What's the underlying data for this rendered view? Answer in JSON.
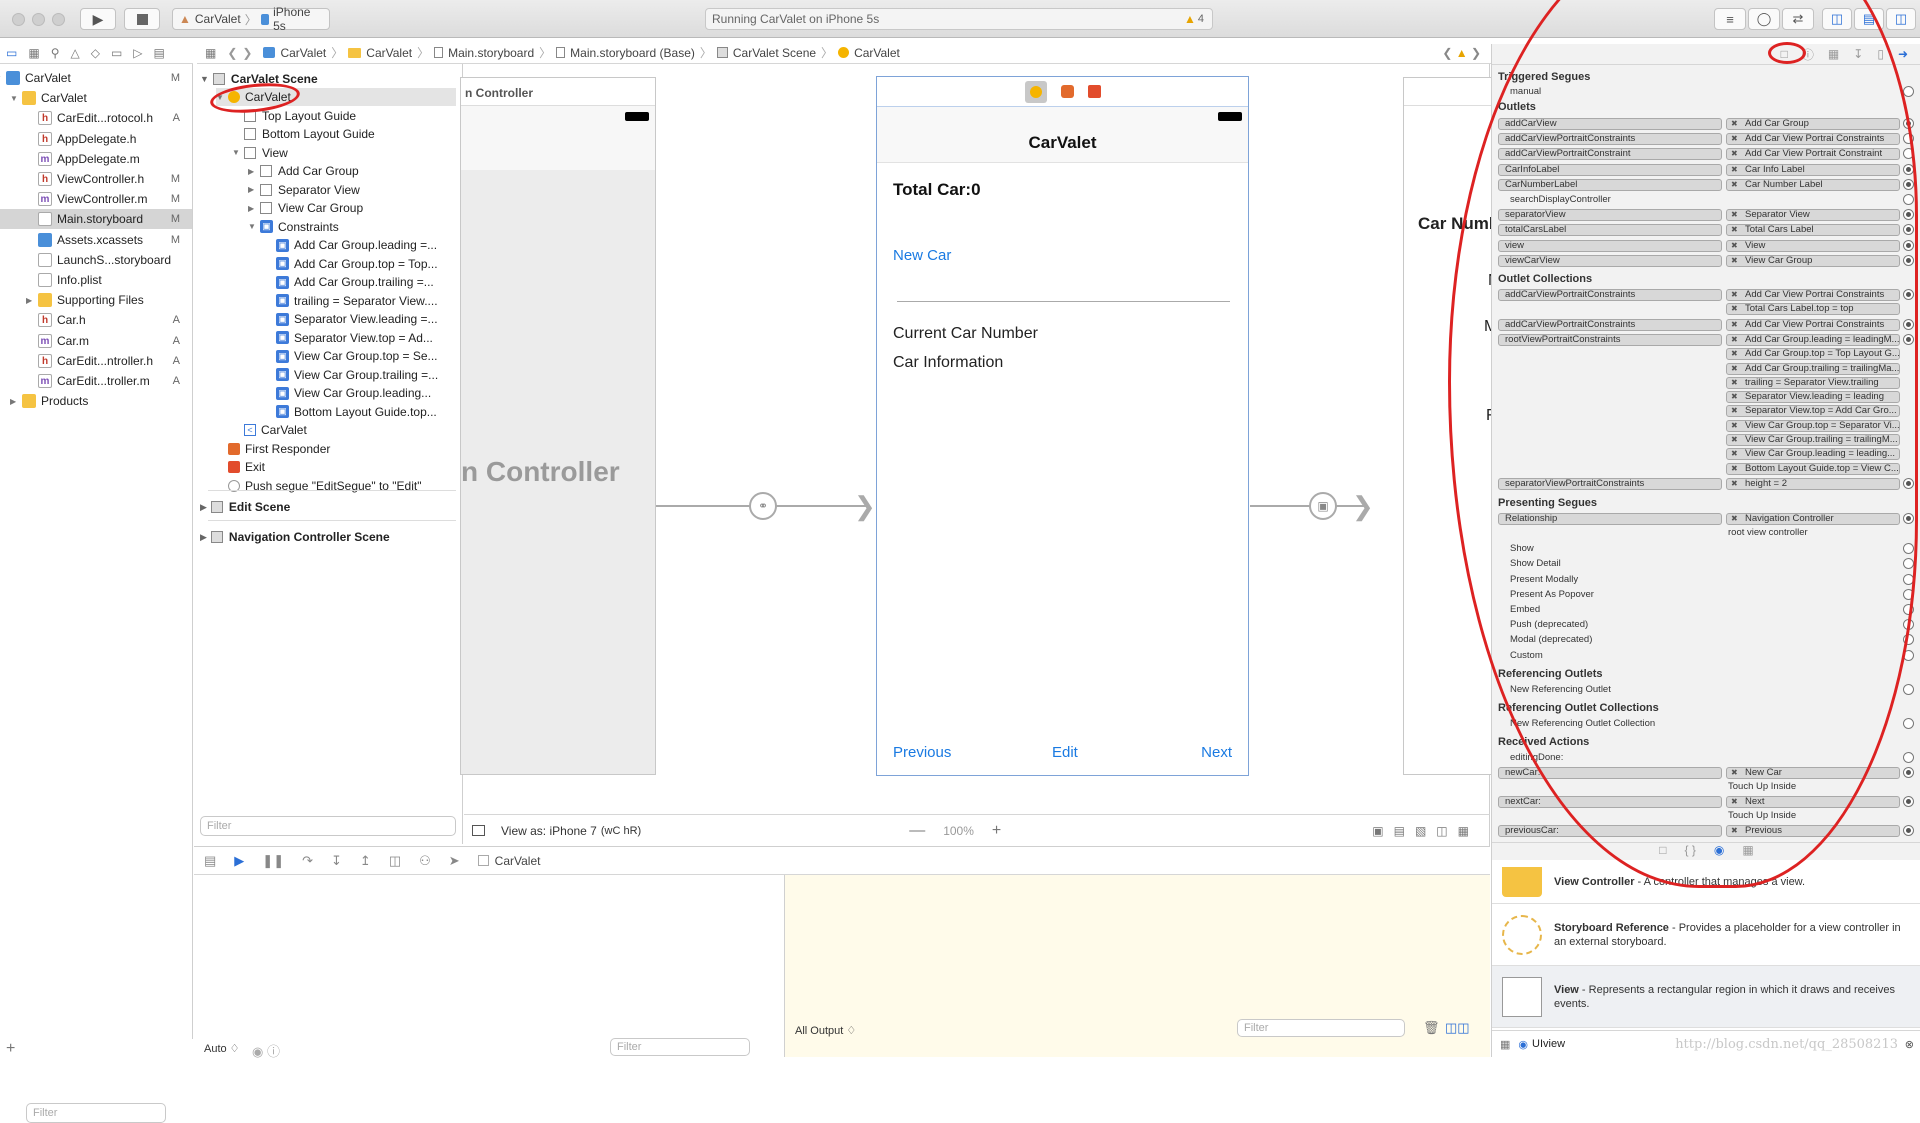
{
  "toolbar": {
    "scheme_app": "CarValet",
    "scheme_device": "iPhone 5s",
    "activity": "Running CarValet on iPhone 5s",
    "warning_count": "4"
  },
  "jumpbar": [
    "CarValet",
    "CarValet",
    "Main.storyboard",
    "Main.storyboard (Base)",
    "CarValet Scene",
    "CarValet"
  ],
  "navigator": {
    "items": [
      {
        "label": "CarValet",
        "badge": "M",
        "level": 0,
        "type": "project"
      },
      {
        "label": "CarValet",
        "badge": "",
        "level": 1,
        "type": "folder"
      },
      {
        "label": "CarEdit...rotocol.h",
        "badge": "A",
        "level": 2,
        "type": "h"
      },
      {
        "label": "AppDelegate.h",
        "badge": "",
        "level": 2,
        "type": "h"
      },
      {
        "label": "AppDelegate.m",
        "badge": "",
        "level": 2,
        "type": "m"
      },
      {
        "label": "ViewController.h",
        "badge": "M",
        "level": 2,
        "type": "h"
      },
      {
        "label": "ViewController.m",
        "badge": "M",
        "level": 2,
        "type": "m"
      },
      {
        "label": "Main.storyboard",
        "badge": "M",
        "level": 2,
        "type": "sb",
        "selected": true
      },
      {
        "label": "Assets.xcassets",
        "badge": "M",
        "level": 2,
        "type": "assets"
      },
      {
        "label": "LaunchS...storyboard",
        "badge": "",
        "level": 2,
        "type": "sb"
      },
      {
        "label": "Info.plist",
        "badge": "",
        "level": 2,
        "type": "plist"
      },
      {
        "label": "Supporting Files",
        "badge": "",
        "level": 2,
        "type": "folder"
      },
      {
        "label": "Car.h",
        "badge": "A",
        "level": 2,
        "type": "h"
      },
      {
        "label": "Car.m",
        "badge": "A",
        "level": 2,
        "type": "m"
      },
      {
        "label": "CarEdit...ntroller.h",
        "badge": "A",
        "level": 2,
        "type": "h"
      },
      {
        "label": "CarEdit...troller.m",
        "badge": "A",
        "level": 2,
        "type": "m"
      },
      {
        "label": "Products",
        "badge": "",
        "level": 1,
        "type": "folder"
      }
    ],
    "filter_placeholder": "Filter"
  },
  "outline": {
    "scene_title": "CarValet Scene",
    "items": [
      {
        "label": "CarValet",
        "level": 1,
        "kind": "vc"
      },
      {
        "label": "Top Layout Guide",
        "level": 2,
        "kind": "box"
      },
      {
        "label": "Bottom Layout Guide",
        "level": 2,
        "kind": "box"
      },
      {
        "label": "View",
        "level": 2,
        "kind": "box"
      },
      {
        "label": "Add Car Group",
        "level": 3,
        "kind": "box"
      },
      {
        "label": "Separator View",
        "level": 3,
        "kind": "box"
      },
      {
        "label": "View Car Group",
        "level": 3,
        "kind": "box"
      },
      {
        "label": "Constraints",
        "level": 3,
        "kind": "cons"
      },
      {
        "label": "Add Car Group.leading =...",
        "level": 4,
        "kind": "c"
      },
      {
        "label": "Add Car Group.top = Top...",
        "level": 4,
        "kind": "c"
      },
      {
        "label": "Add Car Group.trailing =...",
        "level": 4,
        "kind": "c"
      },
      {
        "label": "trailing = Separator View....",
        "level": 4,
        "kind": "c"
      },
      {
        "label": "Separator View.leading =...",
        "level": 4,
        "kind": "c"
      },
      {
        "label": "Separator View.top = Ad...",
        "level": 4,
        "kind": "c"
      },
      {
        "label": "View Car Group.top = Se...",
        "level": 4,
        "kind": "c"
      },
      {
        "label": "View Car Group.trailing =...",
        "level": 4,
        "kind": "c"
      },
      {
        "label": "View Car Group.leading...",
        "level": 4,
        "kind": "c"
      },
      {
        "label": "Bottom Layout Guide.top...",
        "level": 4,
        "kind": "c"
      },
      {
        "label": "CarValet",
        "level": 2,
        "kind": "nav"
      },
      {
        "label": "First Responder",
        "level": 1,
        "kind": "fr"
      },
      {
        "label": "Exit",
        "level": 1,
        "kind": "exit"
      },
      {
        "label": "Push segue \"EditSegue\" to \"Edit\"",
        "level": 1,
        "kind": "segue"
      }
    ],
    "other_scenes": [
      "Edit Scene",
      "Navigation Controller Scene"
    ],
    "filter_placeholder": "Filter"
  },
  "canvas": {
    "left_scene_title": "n Controller",
    "left_scene_big": "n Controller",
    "nav_title": "CarValet",
    "total_car": "Total Car:0",
    "new_car": "New Car",
    "current_car": "Current Car Number",
    "car_info": "Car Information",
    "previous": "Previous",
    "edit": "Edit",
    "next": "Next",
    "right_partial_1": "Car Numb",
    "right_partial_2": "M",
    "right_partial_3": "M",
    "right_partial_4": "F",
    "view_as": "View as: iPhone 7",
    "size_class": "(wC hR)",
    "zoom": "100%"
  },
  "debug": {
    "breadcrumb": "CarValet",
    "auto": "Auto ♢",
    "all_output": "All Output ♢",
    "filter": "Filter"
  },
  "inspector": {
    "triggered_segues": "Triggered Segues",
    "manual": "manual",
    "outlets_title": "Outlets",
    "outlets": [
      {
        "name": "addCarView",
        "target": "Add Car Group",
        "on": true
      },
      {
        "name": "addCarViewPortraitConstraints",
        "target": "Add Car View Portrai Constraints",
        "on": false
      },
      {
        "name": "addCarViewPortraitConstraint",
        "target": "Add Car View Portrait Constraint",
        "on": false
      },
      {
        "name": "CarInfoLabel",
        "target": "Car Info Label",
        "on": true
      },
      {
        "name": "CarNumberLabel",
        "target": "Car Number Label",
        "on": true
      },
      {
        "name": "searchDisplayController",
        "target": "",
        "on": false
      },
      {
        "name": "separatorView",
        "target": "Separator View",
        "on": true
      },
      {
        "name": "totalCarsLabel",
        "target": "Total Cars Label",
        "on": true
      },
      {
        "name": "view",
        "target": "View",
        "on": true
      },
      {
        "name": "viewCarView",
        "target": "View Car Group",
        "on": true
      }
    ],
    "outlet_collections_title": "Outlet Collections",
    "collections": [
      {
        "name": "addCarViewPortraitConstraints",
        "targets": [
          "Add Car View Portrai Constraints",
          "Total Cars Label.top = top"
        ]
      },
      {
        "name": "addCarViewPortraitConstraints",
        "targets": [
          "Add Car View Portrai Constraints"
        ]
      },
      {
        "name": "rootViewPortraitConstraints",
        "targets": [
          "Add Car Group.leading = leadingM...",
          "Add Car Group.top = Top Layout G...",
          "Add Car Group.trailing = trailingMa...",
          "trailing = Separator View.trailing",
          "Separator View.leading = leading",
          "Separator View.top = Add Car Gro...",
          "View Car Group.top = Separator Vi...",
          "View Car Group.trailing = trailingM...",
          "View Car Group.leading = leading...",
          "Bottom Layout Guide.top = View C..."
        ]
      },
      {
        "name": "separatorViewPortraitConstraints",
        "targets": [
          "height = 2"
        ]
      }
    ],
    "presenting_title": "Presenting Segues",
    "relationship": "Relationship",
    "relationship_target": [
      "Navigation Controller",
      "root view controller"
    ],
    "segues": [
      "Show",
      "Show Detail",
      "Present Modally",
      "Present As Popover",
      "Embed",
      "Push (deprecated)",
      "Modal (deprecated)",
      "Custom"
    ],
    "ref_outlets_title": "Referencing Outlets",
    "new_ref_outlet": "New Referencing Outlet",
    "ref_coll_title": "Referencing Outlet Collections",
    "new_ref_coll": "New Referencing Outlet Collection",
    "received_title": "Received Actions",
    "actions": [
      {
        "name": "editingDone:",
        "targets": []
      },
      {
        "name": "newCar:",
        "targets": [
          "New Car",
          "Touch Up Inside"
        ]
      },
      {
        "name": "nextCar:",
        "targets": [
          "Next",
          "Touch Up Inside"
        ]
      },
      {
        "name": "previousCar:",
        "targets": [
          "Previous"
        ]
      }
    ]
  },
  "library": {
    "items": [
      {
        "title": "View Controller",
        "desc": " - A controller that manages a view."
      },
      {
        "title": "Storyboard Reference",
        "desc": " - Provides a placeholder for a view controller in an external storyboard."
      },
      {
        "title": "View",
        "desc": " - Represents a rectangular region in which it draws and receives events."
      }
    ],
    "filter": "UIview",
    "watermark": "http://blog.csdn.net/qq_28508213"
  }
}
